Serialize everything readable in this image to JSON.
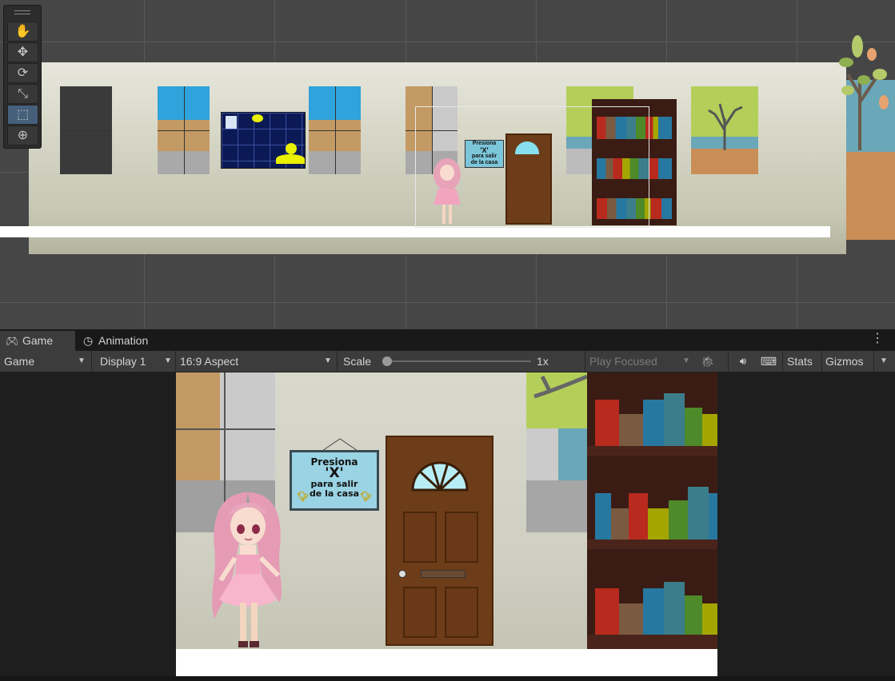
{
  "tabs": [
    {
      "label": "Game",
      "icon": "gamepad-icon",
      "active": true
    },
    {
      "label": "Animation",
      "icon": "clock-icon",
      "active": false
    }
  ],
  "controls": {
    "view_mode": "Game",
    "display": "Display 1",
    "aspect": "16:9 Aspect",
    "scale_label": "Scale",
    "scale_value": "1x",
    "scale_level": 0,
    "play_mode": "Play Focused",
    "stats": "Stats",
    "gizmos": "Gizmos"
  },
  "scene_tools": [
    "hand-tool-icon",
    "move-tool-icon",
    "rotate-tool-icon",
    "scale-tool-icon",
    "rect-tool-icon",
    "transform-tool-icon"
  ],
  "active_tool": "rect-tool-icon",
  "sign": {
    "line1": "Presiona",
    "line2": "'X'",
    "line3": "para salir",
    "line4": "de la casa"
  },
  "colors": {
    "sky": "#2ea3dc",
    "door": "#6d3d19",
    "shelf": "#3a1c14",
    "sign_bg": "#9ad3e3",
    "active_tool": "#46607c"
  }
}
